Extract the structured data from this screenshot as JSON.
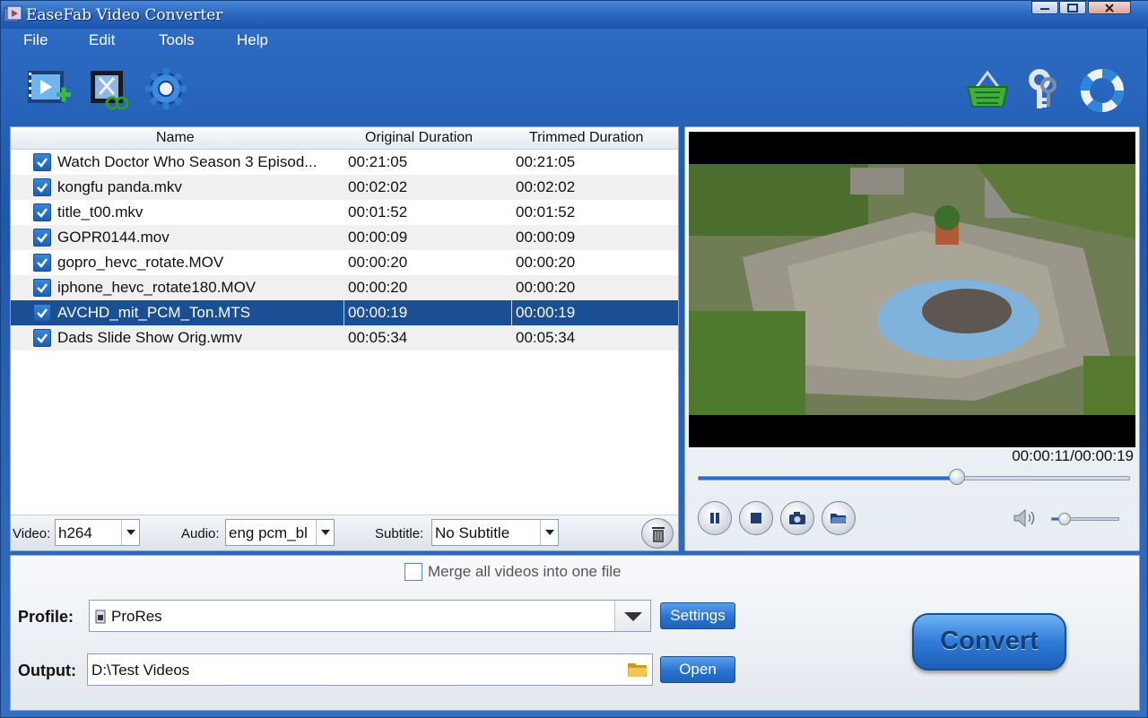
{
  "window": {
    "title": "EaseFab Video Converter"
  },
  "menu": [
    "File",
    "Edit",
    "Tools",
    "Help"
  ],
  "toolbar": {
    "left_icons": [
      "add-video-icon",
      "edit-video-icon",
      "settings-gear-icon"
    ],
    "right_icons": [
      "shopping-basket-icon",
      "register-key-icon",
      "help-lifebuoy-icon"
    ]
  },
  "file_list": {
    "columns": [
      "Name",
      "Original Duration",
      "Trimmed Duration"
    ],
    "rows": [
      {
        "name": "Watch Doctor Who Season 3 Episod...",
        "original": "00:21:05",
        "trimmed": "00:21:05",
        "checked": true,
        "selected": false
      },
      {
        "name": "kongfu panda.mkv",
        "original": "00:02:02",
        "trimmed": "00:02:02",
        "checked": true,
        "selected": false
      },
      {
        "name": "title_t00.mkv",
        "original": "00:01:52",
        "trimmed": "00:01:52",
        "checked": true,
        "selected": false
      },
      {
        "name": "GOPR0144.mov",
        "original": "00:00:09",
        "trimmed": "00:00:09",
        "checked": true,
        "selected": false
      },
      {
        "name": "gopro_hevc_rotate.MOV",
        "original": "00:00:20",
        "trimmed": "00:00:20",
        "checked": true,
        "selected": false
      },
      {
        "name": "iphone_hevc_rotate180.MOV",
        "original": "00:00:20",
        "trimmed": "00:00:20",
        "checked": true,
        "selected": false
      },
      {
        "name": "AVCHD_mit_PCM_Ton.MTS",
        "original": "00:00:19",
        "trimmed": "00:00:19",
        "checked": true,
        "selected": true
      },
      {
        "name": "Dads Slide Show Orig.wmv",
        "original": "00:05:34",
        "trimmed": "00:05:34",
        "checked": true,
        "selected": false
      }
    ]
  },
  "tracks": {
    "video_label": "Video:",
    "video_value": "h264",
    "audio_label": "Audio:",
    "audio_value": "eng pcm_bl",
    "subtitle_label": "Subtitle:",
    "subtitle_value": "No Subtitle"
  },
  "preview": {
    "time": "00:00:11/00:00:19",
    "progress": 0.6,
    "volume": 0.2
  },
  "merge": {
    "label": "Merge all videos into one file",
    "checked": false
  },
  "profile": {
    "label": "Profile:",
    "value": "ProRes",
    "settings_button": "Settings"
  },
  "output": {
    "label": "Output:",
    "value": "D:\\Test Videos",
    "open_button": "Open"
  },
  "convert_button": "Convert",
  "colors": {
    "accent": "#2a72cf",
    "selection": "#1b4f93"
  }
}
